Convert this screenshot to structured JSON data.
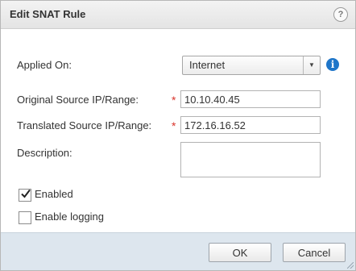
{
  "dialog": {
    "title": "Edit SNAT Rule",
    "help_symbol": "?"
  },
  "form": {
    "applied_on": {
      "label": "Applied On:",
      "value": "Internet",
      "arrow": "▼",
      "info_symbol": "i"
    },
    "original_source": {
      "label": "Original Source IP/Range:",
      "required_marker": "*",
      "value": "10.10.40.45"
    },
    "translated_source": {
      "label": "Translated Source IP/Range:",
      "required_marker": "*",
      "value": "172.16.16.52"
    },
    "description": {
      "label": "Description:",
      "value": ""
    },
    "enabled": {
      "label": "Enabled",
      "checked": true
    },
    "enable_logging": {
      "label": "Enable logging",
      "checked": false
    }
  },
  "footer": {
    "ok_label": "OK",
    "cancel_label": "Cancel"
  },
  "colors": {
    "required": "#d9342b",
    "info": "#1f76c9",
    "footer_bg": "#dde6ee"
  },
  "icons": {
    "help": "help-icon",
    "info": "info-icon",
    "dropdown": "chevron-down-icon",
    "check": "checkmark-icon"
  }
}
